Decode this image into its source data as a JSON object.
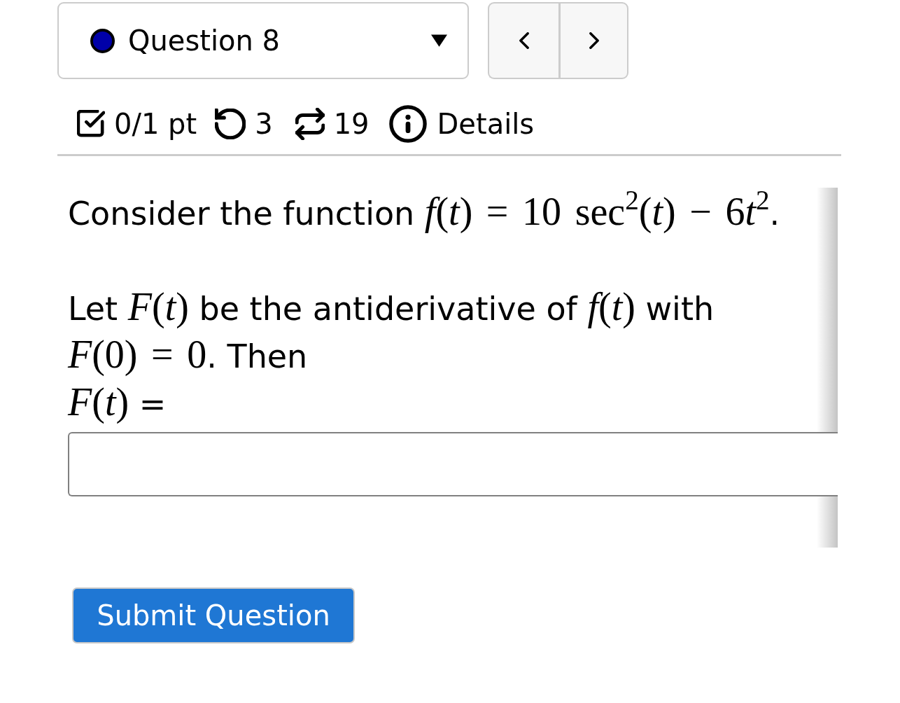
{
  "question_selector": {
    "label": "Question 8"
  },
  "score_bar": {
    "points": "0/1 pt",
    "attempts": "3",
    "versions": "19",
    "details_label": "Details"
  },
  "question": {
    "paragraphs": [
      {
        "parts": [
          {
            "kind": "text",
            "text": "Consider the function "
          },
          {
            "kind": "math",
            "text": "*f*(*t*) = 10 sec$^{2}$(*t*) − 6"
          },
          {
            "kind": "math",
            "text": "*t*$^{2}$"
          },
          {
            "kind": "text",
            "text": "."
          }
        ]
      },
      {
        "parts": [
          {
            "kind": "text",
            "text": "Let "
          },
          {
            "kind": "math",
            "text": "*F*(*t*)"
          },
          {
            "kind": "text",
            "text": " be the antiderivative of "
          },
          {
            "kind": "math",
            "text": "*f*(*t*)"
          },
          {
            "kind": "text",
            "text": " with "
          },
          {
            "kind": "math",
            "text": "*F*(0) = 0"
          },
          {
            "kind": "text",
            "text": ". Then"
          }
        ]
      }
    ],
    "answer_label": {
      "parts": [
        {
          "kind": "math",
          "text": "*F*(*t*)"
        },
        {
          "kind": "text",
          "text": " ="
        }
      ]
    }
  },
  "submit_button": {
    "label": "Submit Question"
  }
}
